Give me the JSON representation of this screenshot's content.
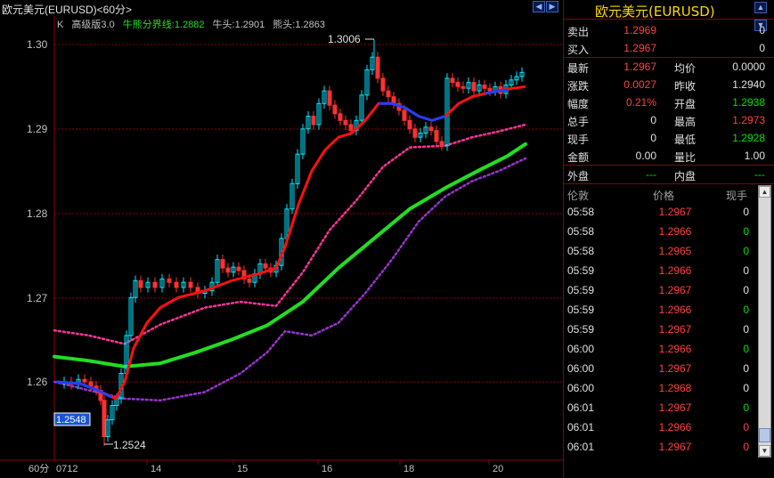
{
  "window": {
    "title": "欧元美元(EURUSD)<60分>"
  },
  "legend": {
    "k_label": "K",
    "version": "高级版3.0",
    "divider": "牛熊分界线:1.2882",
    "bull": "牛头:1.2901",
    "bear": "熊头:1.2863"
  },
  "colors": {
    "background": "#000000",
    "up_candle": "#00e5ff",
    "down_candle": "#ff3030",
    "ma_red": "#ff1010",
    "ma_blue": "#2040ff",
    "divider_green": "#22dd22",
    "band_upper": "#ff3399",
    "band_lower": "#9933cc",
    "grid": "#8b0000"
  },
  "chart": {
    "period_label": "60分",
    "y_ticks": [
      "1.30",
      "1.29",
      "1.28",
      "1.27",
      "1.26"
    ],
    "x_ticks": [
      "0712",
      "14",
      "15",
      "16",
      "18",
      "20"
    ],
    "high_annotation": "1.3006",
    "low_annotation": "1.2524",
    "current_price_tag": "1.2548"
  },
  "chart_data": {
    "type": "candlestick",
    "ylim": [
      1.2515,
      1.301
    ],
    "y_ticks_values": [
      1.3,
      1.29,
      1.28,
      1.27,
      1.26
    ],
    "x_categories": [
      "0712",
      "14",
      "15",
      "16",
      "18",
      "20"
    ],
    "divider_line_start": 1.263,
    "divider_line_end": 1.2882,
    "high": 1.3006,
    "low": 1.2524
  },
  "quote": {
    "title": "欧元美元(EURUSD)",
    "sell_label": "卖出",
    "sell_price": "1.2969",
    "sell_vol": "0",
    "buy_label": "买入",
    "buy_price": "1.2967",
    "buy_vol": "0",
    "latest_label": "最新",
    "latest": "1.2967",
    "avg_label": "均价",
    "avg": "0.0000",
    "change_label": "涨跌",
    "change": "0.0027",
    "prev_close_label": "昨收",
    "prev_close": "1.2940",
    "range_label": "幅度",
    "range": "0.21%",
    "open_label": "开盘",
    "open": "1.2938",
    "total_label": "总手",
    "total": "0",
    "high_label": "最高",
    "high": "1.2973",
    "current_label": "现手",
    "current": "0",
    "low_label": "最低",
    "low": "1.2928",
    "amount_label": "金额",
    "amount": "0.00",
    "ratio_label": "量比",
    "ratio": "1.00",
    "outer_label": "外盘",
    "outer": "---",
    "inner_label": "内盘",
    "inner": "---"
  },
  "trades": {
    "headers": [
      "伦敦",
      "价格",
      "现手"
    ],
    "rows": [
      {
        "time": "05:58",
        "price": "1.2967",
        "vol": "0",
        "dir": "white"
      },
      {
        "time": "05:58",
        "price": "1.2966",
        "vol": "0",
        "dir": "green"
      },
      {
        "time": "05:58",
        "price": "1.2965",
        "vol": "0",
        "dir": "green"
      },
      {
        "time": "05:59",
        "price": "1.2966",
        "vol": "0",
        "dir": "white"
      },
      {
        "time": "05:59",
        "price": "1.2967",
        "vol": "0",
        "dir": "white"
      },
      {
        "time": "05:59",
        "price": "1.2966",
        "vol": "0",
        "dir": "green"
      },
      {
        "time": "05:59",
        "price": "1.2967",
        "vol": "0",
        "dir": "white"
      },
      {
        "time": "06:00",
        "price": "1.2966",
        "vol": "0",
        "dir": "green"
      },
      {
        "time": "06:00",
        "price": "1.2967",
        "vol": "0",
        "dir": "white"
      },
      {
        "time": "06:00",
        "price": "1.2968",
        "vol": "0",
        "dir": "white"
      },
      {
        "time": "06:01",
        "price": "1.2967",
        "vol": "0",
        "dir": "green"
      },
      {
        "time": "06:01",
        "price": "1.2966",
        "vol": "0",
        "dir": "red"
      },
      {
        "time": "06:01",
        "price": "1.2967",
        "vol": "0",
        "dir": "red"
      }
    ]
  }
}
